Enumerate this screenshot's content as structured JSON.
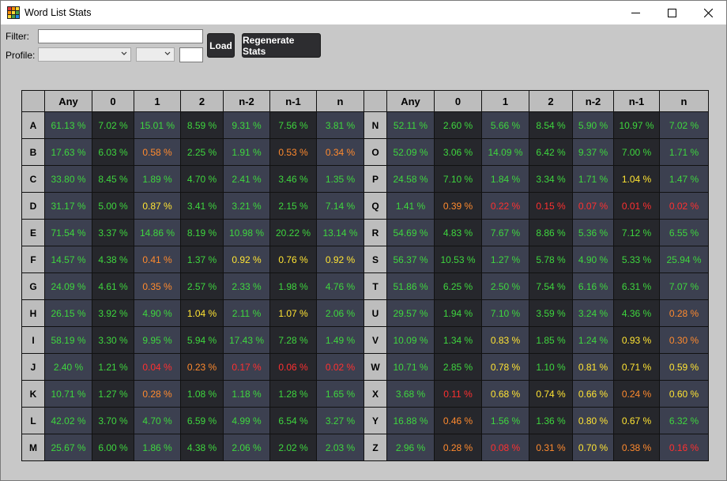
{
  "window": {
    "title": "Word List Stats",
    "icon": "grid-app-icon",
    "controls": [
      "minimize-icon",
      "maximize-icon",
      "close-icon"
    ]
  },
  "toolbar": {
    "filter_label": "Filter:",
    "filter_value": "",
    "profile_label": "Profile:",
    "profile_value": "",
    "profile2_value": "",
    "profile_extra_value": "",
    "load_label": "Load",
    "regen_label": "Regenerate Stats"
  },
  "colors": {
    "good": "#3ed63e",
    "mid": "#ffe433",
    "warn": "#ff8a2e",
    "bad": "#ff3030",
    "cell_bg_a": "#3c4050",
    "cell_bg_b": "#26272c",
    "header_bg": "#bdbdbd"
  },
  "table": {
    "columns": [
      "Any",
      "0",
      "1",
      "2",
      "n-2",
      "n-1",
      "n"
    ],
    "left": [
      {
        "letter": "A",
        "values": [
          "61.13 %",
          "7.02 %",
          "15.01 %",
          "8.59 %",
          "9.31 %",
          "7.56 %",
          "3.81 %"
        ],
        "levels": [
          "g",
          "g",
          "g",
          "g",
          "g",
          "g",
          "g"
        ]
      },
      {
        "letter": "B",
        "values": [
          "17.63 %",
          "6.03 %",
          "0.58 %",
          "2.25 %",
          "1.91 %",
          "0.53 %",
          "0.34 %"
        ],
        "levels": [
          "g",
          "g",
          "w",
          "g",
          "g",
          "w",
          "w"
        ]
      },
      {
        "letter": "C",
        "values": [
          "33.80 %",
          "8.45 %",
          "1.89 %",
          "4.70 %",
          "2.41 %",
          "3.46 %",
          "1.35 %"
        ],
        "levels": [
          "g",
          "g",
          "g",
          "g",
          "g",
          "g",
          "g"
        ]
      },
      {
        "letter": "D",
        "values": [
          "31.17 %",
          "5.00 %",
          "0.87 %",
          "3.41 %",
          "3.21 %",
          "2.15 %",
          "7.14 %"
        ],
        "levels": [
          "g",
          "g",
          "m",
          "g",
          "g",
          "g",
          "g"
        ]
      },
      {
        "letter": "E",
        "values": [
          "71.54 %",
          "3.37 %",
          "14.86 %",
          "8.19 %",
          "10.98 %",
          "20.22 %",
          "13.14 %"
        ],
        "levels": [
          "g",
          "g",
          "g",
          "g",
          "g",
          "g",
          "g"
        ]
      },
      {
        "letter": "F",
        "values": [
          "14.57 %",
          "4.38 %",
          "0.41 %",
          "1.37 %",
          "0.92 %",
          "0.76 %",
          "0.92 %"
        ],
        "levels": [
          "g",
          "g",
          "w",
          "g",
          "m",
          "m",
          "m"
        ]
      },
      {
        "letter": "G",
        "values": [
          "24.09 %",
          "4.61 %",
          "0.35 %",
          "2.57 %",
          "2.33 %",
          "1.98 %",
          "4.76 %"
        ],
        "levels": [
          "g",
          "g",
          "w",
          "g",
          "g",
          "g",
          "g"
        ]
      },
      {
        "letter": "H",
        "values": [
          "26.15 %",
          "3.92 %",
          "4.90 %",
          "1.04 %",
          "2.11 %",
          "1.07 %",
          "2.06 %"
        ],
        "levels": [
          "g",
          "g",
          "g",
          "m",
          "g",
          "m",
          "g"
        ]
      },
      {
        "letter": "I",
        "values": [
          "58.19 %",
          "3.30 %",
          "9.95 %",
          "5.94 %",
          "17.43 %",
          "7.28 %",
          "1.49 %"
        ],
        "levels": [
          "g",
          "g",
          "g",
          "g",
          "g",
          "g",
          "g"
        ]
      },
      {
        "letter": "J",
        "values": [
          "2.40 %",
          "1.21 %",
          "0.04 %",
          "0.23 %",
          "0.17 %",
          "0.06 %",
          "0.02 %"
        ],
        "levels": [
          "g",
          "g",
          "b",
          "w",
          "b",
          "b",
          "b"
        ]
      },
      {
        "letter": "K",
        "values": [
          "10.71 %",
          "1.27 %",
          "0.28 %",
          "1.08 %",
          "1.18 %",
          "1.28 %",
          "1.65 %"
        ],
        "levels": [
          "g",
          "g",
          "w",
          "g",
          "g",
          "g",
          "g"
        ]
      },
      {
        "letter": "L",
        "values": [
          "42.02 %",
          "3.70 %",
          "4.70 %",
          "6.59 %",
          "4.99 %",
          "6.54 %",
          "3.27 %"
        ],
        "levels": [
          "g",
          "g",
          "g",
          "g",
          "g",
          "g",
          "g"
        ]
      },
      {
        "letter": "M",
        "values": [
          "25.67 %",
          "6.00 %",
          "1.86 %",
          "4.38 %",
          "2.06 %",
          "2.02 %",
          "2.03 %"
        ],
        "levels": [
          "g",
          "g",
          "g",
          "g",
          "g",
          "g",
          "g"
        ]
      }
    ],
    "right": [
      {
        "letter": "N",
        "values": [
          "52.11 %",
          "2.60 %",
          "5.66 %",
          "8.54 %",
          "5.90 %",
          "10.97 %",
          "7.02 %"
        ],
        "levels": [
          "g",
          "g",
          "g",
          "g",
          "g",
          "g",
          "g"
        ]
      },
      {
        "letter": "O",
        "values": [
          "52.09 %",
          "3.06 %",
          "14.09 %",
          "6.42 %",
          "9.37 %",
          "7.00 %",
          "1.71 %"
        ],
        "levels": [
          "g",
          "g",
          "g",
          "g",
          "g",
          "g",
          "g"
        ]
      },
      {
        "letter": "P",
        "values": [
          "24.58 %",
          "7.10 %",
          "1.84 %",
          "3.34 %",
          "1.71 %",
          "1.04 %",
          "1.47 %"
        ],
        "levels": [
          "g",
          "g",
          "g",
          "g",
          "g",
          "m",
          "g"
        ]
      },
      {
        "letter": "Q",
        "values": [
          "1.41 %",
          "0.39 %",
          "0.22 %",
          "0.15 %",
          "0.07 %",
          "0.01 %",
          "0.02 %"
        ],
        "levels": [
          "g",
          "w",
          "b",
          "b",
          "b",
          "b",
          "b"
        ]
      },
      {
        "letter": "R",
        "values": [
          "54.69 %",
          "4.83 %",
          "7.67 %",
          "8.86 %",
          "5.36 %",
          "7.12 %",
          "6.55 %"
        ],
        "levels": [
          "g",
          "g",
          "g",
          "g",
          "g",
          "g",
          "g"
        ]
      },
      {
        "letter": "S",
        "values": [
          "56.37 %",
          "10.53 %",
          "1.27 %",
          "5.78 %",
          "4.90 %",
          "5.33 %",
          "25.94 %"
        ],
        "levels": [
          "g",
          "g",
          "g",
          "g",
          "g",
          "g",
          "g"
        ]
      },
      {
        "letter": "T",
        "values": [
          "51.86 %",
          "6.25 %",
          "2.50 %",
          "7.54 %",
          "6.16 %",
          "6.31 %",
          "7.07 %"
        ],
        "levels": [
          "g",
          "g",
          "g",
          "g",
          "g",
          "g",
          "g"
        ]
      },
      {
        "letter": "U",
        "values": [
          "29.57 %",
          "1.94 %",
          "7.10 %",
          "3.59 %",
          "3.24 %",
          "4.36 %",
          "0.28 %"
        ],
        "levels": [
          "g",
          "g",
          "g",
          "g",
          "g",
          "g",
          "w"
        ]
      },
      {
        "letter": "V",
        "values": [
          "10.09 %",
          "1.34 %",
          "0.83 %",
          "1.85 %",
          "1.24 %",
          "0.93 %",
          "0.30 %"
        ],
        "levels": [
          "g",
          "g",
          "m",
          "g",
          "g",
          "m",
          "w"
        ]
      },
      {
        "letter": "W",
        "values": [
          "10.71 %",
          "2.85 %",
          "0.78 %",
          "1.10 %",
          "0.81 %",
          "0.71 %",
          "0.59 %"
        ],
        "levels": [
          "g",
          "g",
          "m",
          "g",
          "m",
          "m",
          "m"
        ]
      },
      {
        "letter": "X",
        "values": [
          "3.68 %",
          "0.11 %",
          "0.68 %",
          "0.74 %",
          "0.66 %",
          "0.24 %",
          "0.60 %"
        ],
        "levels": [
          "g",
          "b",
          "m",
          "m",
          "m",
          "w",
          "m"
        ]
      },
      {
        "letter": "Y",
        "values": [
          "16.88 %",
          "0.46 %",
          "1.56 %",
          "1.36 %",
          "0.80 %",
          "0.67 %",
          "6.32 %"
        ],
        "levels": [
          "g",
          "w",
          "g",
          "g",
          "m",
          "m",
          "g"
        ]
      },
      {
        "letter": "Z",
        "values": [
          "2.96 %",
          "0.28 %",
          "0.08 %",
          "0.31 %",
          "0.70 %",
          "0.38 %",
          "0.16 %"
        ],
        "levels": [
          "g",
          "w",
          "b",
          "w",
          "m",
          "w",
          "b"
        ]
      }
    ]
  }
}
